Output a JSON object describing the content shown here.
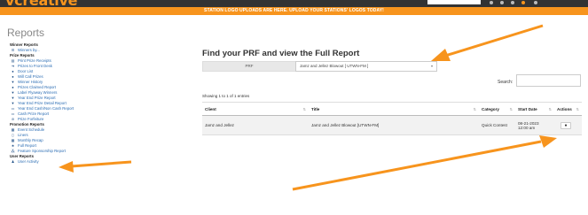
{
  "topbar": {
    "brand": "vcreative"
  },
  "banner": {
    "text": "STATION LOGO UPLOADS ARE HERE. UPLOAD YOUR STATIONS' LOGOS TODAY!"
  },
  "page": {
    "title": "Reports"
  },
  "sidebar": {
    "sections": [
      {
        "head": "Winner Reports",
        "items": [
          {
            "label": "Winners by...",
            "icon": "list-icon"
          }
        ]
      },
      {
        "head": "Prize Reports",
        "items": [
          {
            "label": "Print Prize Receipts",
            "icon": "print-icon"
          },
          {
            "label": "Prizes to Front Desk",
            "icon": "arrow-circle-icon"
          },
          {
            "label": "Door List",
            "icon": "info-icon"
          },
          {
            "label": "Will Call Prizes",
            "icon": "info-icon"
          },
          {
            "label": "Winner History",
            "icon": "trophy-icon"
          },
          {
            "label": "Prizes Claimed Report",
            "icon": "check-circle-icon"
          },
          {
            "label": "Label Flyaway Winners",
            "icon": "trophy-icon"
          },
          {
            "label": "Year End Prize Report",
            "icon": "trophy-icon"
          },
          {
            "label": "Year End Prize Detail Report",
            "icon": "trophy-icon"
          },
          {
            "label": "Year End Cash/Non Cash Report",
            "icon": "money-icon"
          },
          {
            "label": "Cash Prize Report",
            "icon": "money-icon"
          },
          {
            "label": "Prize Forfeiture",
            "icon": "ban-icon"
          }
        ]
      },
      {
        "head": "Promotion Reports",
        "items": [
          {
            "label": "Event Schedule",
            "icon": "calendar-icon"
          },
          {
            "label": "Liners",
            "icon": "document-icon"
          },
          {
            "label": "Monthly Recap",
            "icon": "calendar-icon"
          },
          {
            "label": "Full Report",
            "icon": "star-icon"
          },
          {
            "label": "Feature Sponsorship Report",
            "icon": "sitemap-icon"
          }
        ]
      },
      {
        "head": "User Reports",
        "items": [
          {
            "label": "User Activity",
            "icon": "user-icon"
          }
        ]
      }
    ]
  },
  "main": {
    "title": "Find your PRF and view the Full Report",
    "prf_label": "PRF",
    "prf_value": "Jamz and Jellez Blowout [ UTWN-FM ]",
    "search_label": "Search:",
    "search_value": "",
    "entries_text": "Showing 1 to 1 of 1 entries",
    "table": {
      "headers": [
        "Client",
        "Title",
        "Category",
        "Start Date",
        "Actions"
      ],
      "rows": [
        {
          "client": "Jamz and Jellez",
          "title": "Jamz and Jellez Blowout [UTWN-FM]",
          "category": "Quick Contest",
          "start_date": "08-21-2023",
          "start_time": "12:00 am"
        }
      ]
    }
  },
  "colors": {
    "accent": "#f7941d",
    "link": "#2a6cb3",
    "topbar": "#333333"
  }
}
